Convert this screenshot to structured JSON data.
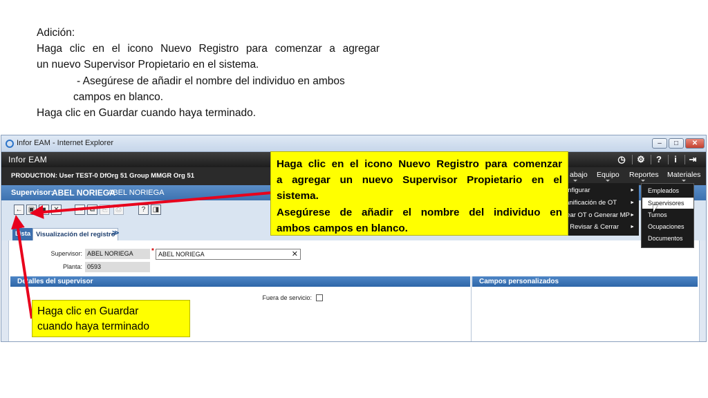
{
  "slide": {
    "lines": [
      "Adición:",
      "Haga clic en el icono Nuevo Registro para comenzar a agregar",
      "un nuevo Supervisor Propietario en el sistema.",
      "- Asegúrese de  añadir el nombre del individuo en ambos",
      "campos en blanco.",
      "Haga clic en Guardar cuando haya terminado."
    ]
  },
  "browser": {
    "title": "Infor EAM - Internet Explorer",
    "controls": [
      "–",
      "□",
      "✕"
    ]
  },
  "app": {
    "brand": "Infor EAM",
    "production": "PRODUCTION: User TEST-0 DfOrg 51 Group MMGR Org 51",
    "header_icons": [
      "clock-icon",
      "gear-icon",
      "help-icon",
      "info-icon",
      "logout-icon"
    ],
    "header_glyphs": [
      "◷",
      "⚙",
      "?",
      "i",
      "⇥"
    ],
    "nav": [
      "abajo",
      "Equipo",
      "Reportes",
      "Materiales"
    ]
  },
  "record": {
    "label": "Supervisor:",
    "code": "ABEL NORIEGA",
    "description": "ABEL NORIEGA"
  },
  "toolbar": {
    "buttons": [
      "←",
      "▣",
      "■",
      "✕",
      "⇥",
      "⧉",
      "⎘",
      "⎙",
      "?",
      "◨"
    ]
  },
  "tabs": {
    "list": "Lista",
    "record_view": "Visualización del registro",
    "more": "≫"
  },
  "form": {
    "supervisor_label": "Supervisor:",
    "supervisor_code": "ABEL NORIEGA",
    "supervisor_name": "ABEL NORIEGA",
    "plant_label": "Planta:",
    "plant_value": "0593",
    "required_mark": "*",
    "clear_glyph": "✕",
    "details_header": "Detalles del supervisor",
    "custom_header": "Campos personalizados",
    "out_of_service_label": "Fuera de servicio:"
  },
  "dropdown": {
    "items": [
      "onfigurar",
      "lanificación de OT",
      "rear OT o Generar MP",
      "T Revisar & Cerrar"
    ],
    "arrow": "►"
  },
  "submenu": {
    "items": [
      "Empleados",
      "Supervisores",
      "Turnos",
      "Ocupaciones",
      "Documentos"
    ],
    "highlighted": "Supervisores"
  },
  "callouts": {
    "top_lines": [
      "Haga clic en el icono Nuevo Registro para comenzar",
      "a agregar un nuevo Supervisor Propietario en el",
      "sistema.",
      "Asegúrese de añadir el nombre del individuo en",
      "ambos campos en blanco."
    ],
    "bottom_lines": [
      "Haga clic en Guardar",
      "cuando haya terminado"
    ]
  },
  "colors": {
    "callout": "#ffff00",
    "arrow": "#e8001c",
    "record_bar": "#3d72b0"
  }
}
